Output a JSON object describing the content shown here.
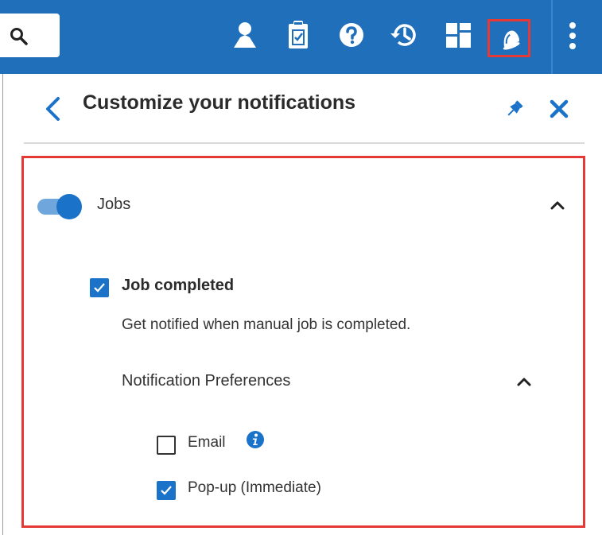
{
  "topbar": {
    "icons": [
      "search-icon",
      "user-icon",
      "clipboard-check-icon",
      "help-icon",
      "history-icon",
      "dashboard-icon",
      "bell-icon",
      "more-vertical-icon"
    ],
    "bar_color": "#1f6fba",
    "highlight_color": "#e53935"
  },
  "panel": {
    "title": "Customize your notifications",
    "sections": [
      {
        "label": "Jobs",
        "enabled": true,
        "expanded": true,
        "items": [
          {
            "label": "Job completed",
            "checked": true,
            "description": "Get notified when manual job is completed.",
            "preferences": {
              "heading": "Notification Preferences",
              "expanded": true,
              "options": [
                {
                  "label": "Email",
                  "checked": false,
                  "info_icon": "info-icon"
                },
                {
                  "label": "Pop-up (Immediate)",
                  "checked": true
                }
              ]
            }
          }
        ]
      }
    ]
  },
  "colors": {
    "accent": "#1a73c9",
    "text": "#2b2b2b"
  }
}
